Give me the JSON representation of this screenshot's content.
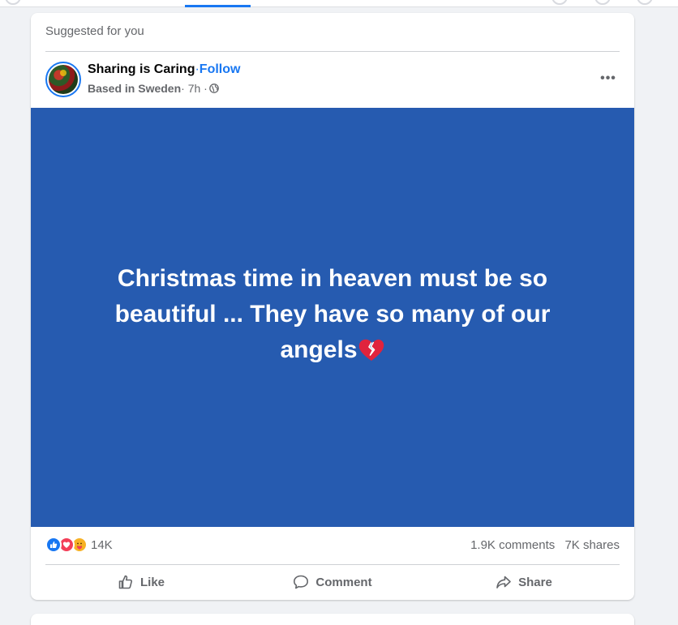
{
  "feed": {
    "suggested_label": "Suggested for you"
  },
  "post": {
    "page_name": "Sharing is Caring",
    "separator": "·",
    "follow_label": "Follow",
    "location": "Based in Sweden",
    "time": "· 7h ·",
    "privacy_icon": "globe-icon",
    "more_label": "•••",
    "text": "Christmas time in heaven must be so beautiful ... They have so many of our angels",
    "text_emoji": "broken-heart-icon",
    "background_color": "#265bb0"
  },
  "stats": {
    "reactions": [
      "like-icon",
      "love-icon",
      "care-icon"
    ],
    "reaction_count": "14K",
    "comments": "1.9K comments",
    "shares": "7K shares"
  },
  "actions": {
    "like": "Like",
    "comment": "Comment",
    "share": "Share"
  },
  "colors": {
    "accent": "#1877f2",
    "secondary_text": "#65676b",
    "background": "#f0f2f5"
  }
}
